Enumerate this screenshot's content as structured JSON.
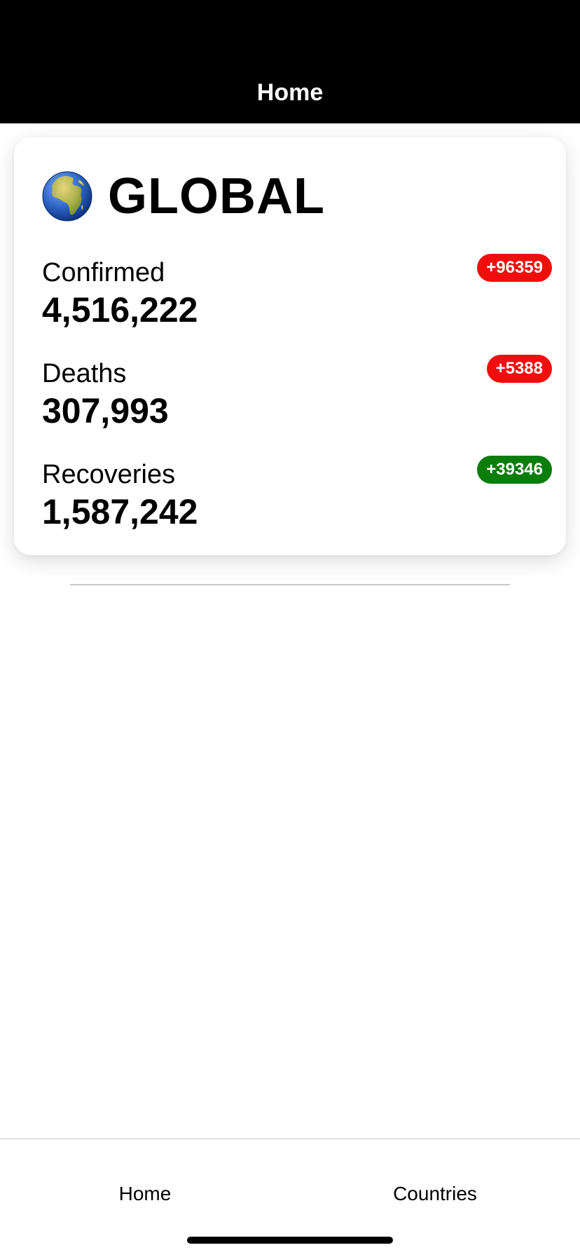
{
  "nav": {
    "title": "Home"
  },
  "card": {
    "icon": "globe-earth-africa-icon",
    "title": "GLOBAL",
    "stats": [
      {
        "label": "Confirmed",
        "value": "4,516,222",
        "delta": "+96359",
        "delta_color": "#f20d0d"
      },
      {
        "label": "Deaths",
        "value": "307,993",
        "delta": "+5388",
        "delta_color": "#f20d0d"
      },
      {
        "label": "Recoveries",
        "value": "1,587,242",
        "delta": "+39346",
        "delta_color": "#0a7d0a"
      }
    ]
  },
  "tabs": [
    {
      "label": "Home",
      "selected": true
    },
    {
      "label": "Countries",
      "selected": false
    }
  ],
  "colors": {
    "nav_background": "#000000",
    "increase_badge": "#f20d0d",
    "recovery_badge": "#0a7d0a"
  }
}
